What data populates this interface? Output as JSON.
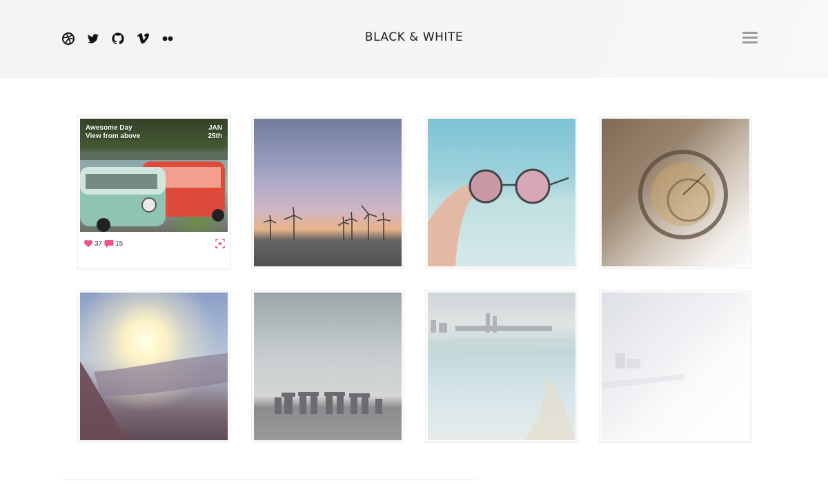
{
  "header": {
    "brand": "BLACK & WHITE",
    "social_icons": [
      "dribbble-icon",
      "twitter-icon",
      "github-icon",
      "vimeo-icon",
      "flickr-icon"
    ],
    "menu_icon": "hamburger-menu-icon",
    "background": "#f5f5f5"
  },
  "featured": {
    "title_line1": "Awesome Day",
    "title_line2": "View from above",
    "date_month": "JAN",
    "date_day": "25th",
    "likes": "37",
    "comments": "15",
    "accent": "#e8558b"
  },
  "photos": [
    {
      "subject": "vw-buses"
    },
    {
      "subject": "wind-turbines-sunset"
    },
    {
      "subject": "sunglasses-beach"
    },
    {
      "subject": "astronomical-clock"
    },
    {
      "subject": "sun-over-hills"
    },
    {
      "subject": "stonehenge"
    },
    {
      "subject": "beach-city"
    },
    {
      "subject": "faded-coast"
    }
  ]
}
